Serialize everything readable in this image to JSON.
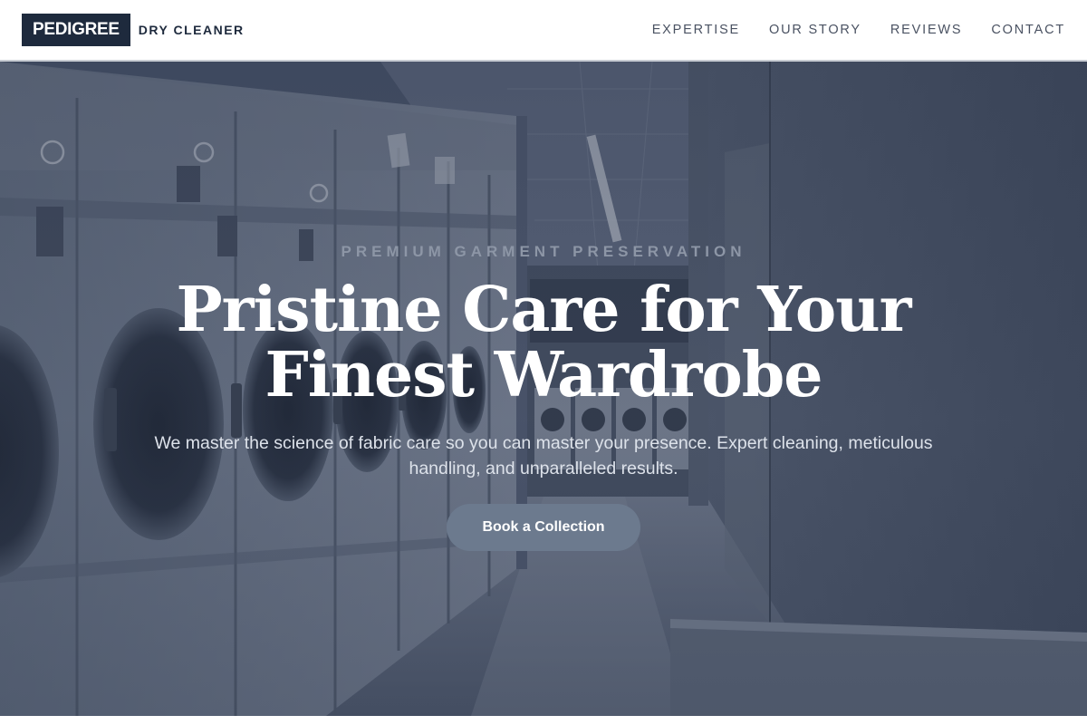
{
  "nav": {
    "brand": "PEDIGREE",
    "brand_sub": "DRY CLEANER",
    "links": [
      {
        "label": "EXPERTISE"
      },
      {
        "label": "OUR STORY"
      },
      {
        "label": "REVIEWS"
      },
      {
        "label": "CONTACT"
      }
    ]
  },
  "hero": {
    "eyebrow": "PREMIUM GARMENT PRESERVATION",
    "headline_line1": "Pristine Care for Your",
    "headline_line2": "Finest Wardrobe",
    "subtext": "We master the science of fabric care so you can master your presence. Expert cleaning, meticulous handling, and unparalleled results.",
    "cta_label": "Book a Collection"
  },
  "colors": {
    "brand_navy": "#1e2a3d",
    "cta_bg": "#6c7a8e",
    "nav_text": "#4a5262"
  }
}
